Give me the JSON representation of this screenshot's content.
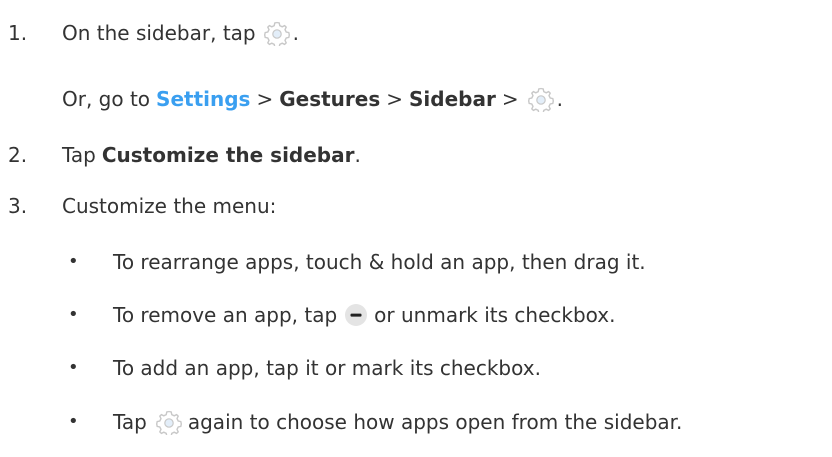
{
  "steps": [
    {
      "number": "1.",
      "text_before": "On the sidebar, tap",
      "text_after": "."
    },
    {
      "number": "2.",
      "text_before": "Tap",
      "bold": "Customize the sidebar",
      "text_after": "."
    },
    {
      "number": "3.",
      "text": "Customize the menu:"
    }
  ],
  "alt_path": {
    "prefix": "Or, go to",
    "settings": "Settings",
    "gestures": "Gestures",
    "sidebar": "Sidebar",
    "separator": ">",
    "suffix": "."
  },
  "bullets": [
    {
      "text": "To rearrange apps, touch & hold an app, then drag it."
    },
    {
      "text_before": "To remove an app, tap",
      "text_after": "or unmark its checkbox."
    },
    {
      "text": "To add an app, tap it or mark its checkbox."
    },
    {
      "text_before": "Tap",
      "text_after": "again to choose how apps open from the sidebar."
    }
  ],
  "bullet_char": "•",
  "colors": {
    "text": "#333333",
    "link": "#3a9ff0",
    "icon_gray": "#c8c8c8",
    "icon_blue_accent": "#e3eef9"
  },
  "icons": [
    "gear-icon",
    "minus-circle-icon"
  ]
}
